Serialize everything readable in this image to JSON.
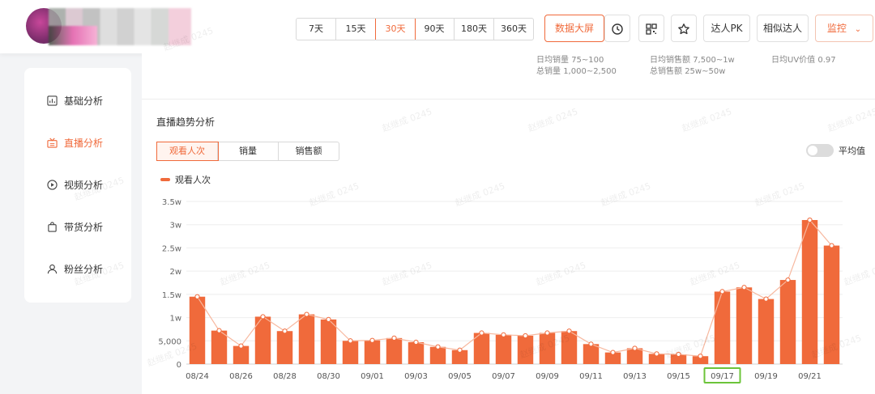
{
  "periods": [
    "7天",
    "15天",
    "30天",
    "90天",
    "180天",
    "360天"
  ],
  "active_period": "30天",
  "toolbar": {
    "dashboard": "数据大屏",
    "pk": "达人PK",
    "similar": "相似达人",
    "monitor": "监控"
  },
  "stats": {
    "daily_sales": "日均销量",
    "daily_sales_val": "75~100",
    "total_sales": "总销量",
    "total_sales_val": "1,000~2,500",
    "daily_gmv": "日均销售额",
    "daily_gmv_val": "7,500~1w",
    "total_gmv": "总销售额",
    "total_gmv_val": "25w~50w",
    "uv": "日均UV价值",
    "uv_val": "0.97"
  },
  "sidebar": {
    "items": [
      {
        "label": "基础分析",
        "icon": "chart-box-icon",
        "active": false
      },
      {
        "label": "直播分析",
        "icon": "live-tv-icon",
        "active": true
      },
      {
        "label": "视频分析",
        "icon": "play-circle-icon",
        "active": false
      },
      {
        "label": "带货分析",
        "icon": "shopping-bag-icon",
        "active": false
      },
      {
        "label": "粉丝分析",
        "icon": "user-icon",
        "active": false
      }
    ]
  },
  "section": {
    "title": "直播趋势分析",
    "tabs": [
      "观看人次",
      "销量",
      "销售额"
    ],
    "active_tab": "观看人次",
    "avg_toggle": "平均值"
  },
  "watermark_text": "赵继成 0245",
  "colors": {
    "accent": "#f06a3b",
    "highlight_box": "#6cc43a"
  },
  "chart_data": {
    "type": "bar",
    "legend": "观看人次",
    "ylim": [
      0,
      35000
    ],
    "yticks": [
      "0",
      "5,000",
      "1w",
      "1.5w",
      "2w",
      "2.5w",
      "3w",
      "3.5w"
    ],
    "ytick_values": [
      0,
      5000,
      10000,
      15000,
      20000,
      25000,
      30000,
      35000
    ],
    "categories": [
      "08/24",
      "08/25",
      "08/26",
      "08/27",
      "08/28",
      "08/29",
      "08/30",
      "08/31",
      "09/01",
      "09/02",
      "09/03",
      "09/04",
      "09/05",
      "09/06",
      "09/07",
      "09/08",
      "09/09",
      "09/10",
      "09/11",
      "09/12",
      "09/13",
      "09/14",
      "09/15",
      "09/16",
      "09/17",
      "09/18",
      "09/19",
      "09/20",
      "09/21",
      "09/22"
    ],
    "xticks_shown": [
      "08/24",
      "08/26",
      "08/28",
      "08/30",
      "09/01",
      "09/03",
      "09/05",
      "09/07",
      "09/09",
      "09/11",
      "09/13",
      "09/15",
      "09/17",
      "09/19",
      "09/21"
    ],
    "highlighted_tick": "09/17",
    "values": [
      14500,
      7200,
      3900,
      10200,
      7100,
      10700,
      9600,
      5000,
      5100,
      5600,
      4700,
      3700,
      3000,
      6700,
      6300,
      6100,
      6700,
      7100,
      4300,
      2500,
      3400,
      2200,
      2100,
      1700,
      15600,
      16500,
      14000,
      18100,
      31000,
      25500
    ]
  }
}
